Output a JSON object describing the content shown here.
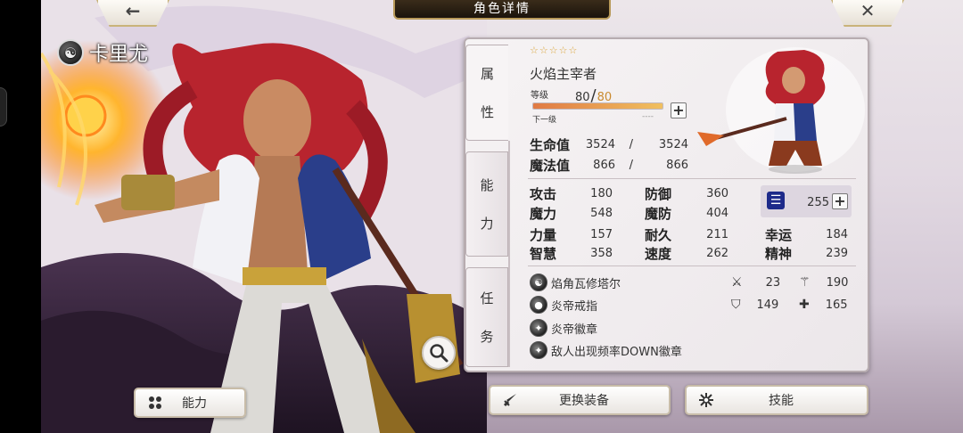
{
  "header": {
    "title": "角色详情",
    "back_glyph": "←",
    "close_glyph": "✕"
  },
  "character": {
    "name": "卡里尤",
    "element_icon": "dark-element-icon"
  },
  "tabs": {
    "attributes": [
      "属",
      "性"
    ],
    "ability": [
      "能",
      "力"
    ],
    "quest": [
      "任",
      "务"
    ]
  },
  "profile": {
    "stars": "☆☆☆☆☆",
    "title": "火焰主宰者",
    "level_label": "等级",
    "level": "80",
    "level_sep": "/",
    "level_max": "80",
    "level_progress": 1.0,
    "next_label": "下一级",
    "next_value": "----"
  },
  "vitals": [
    {
      "label": "生命值",
      "current": "3524",
      "sep": "/",
      "max": "3524"
    },
    {
      "label": "魔法值",
      "current": "866",
      "sep": "/",
      "max": "866"
    }
  ],
  "stats": {
    "atk_label": "攻击",
    "atk": "180",
    "def_label": "防御",
    "def": "360",
    "mag_label": "魔力",
    "mag": "548",
    "mdef_label": "魔防",
    "mdef": "404",
    "crest_value": "255",
    "str_label": "力量",
    "str": "157",
    "vit_label": "耐久",
    "vit": "211",
    "luck_label": "幸运",
    "luck": "184",
    "wis_label": "智慧",
    "wis": "358",
    "spd_label": "速度",
    "spd": "262",
    "spi_label": "精神",
    "spi": "239"
  },
  "equipment": [
    {
      "name": "焰角瓦修塔尔",
      "icon": "weapon-orb-icon"
    },
    {
      "name": "炎帝戒指",
      "icon": "ring-icon"
    },
    {
      "name": "炎帝徽章",
      "icon": "emblem-icon"
    },
    {
      "name": "敌人出现频率DOWN徽章",
      "icon": "emblem-icon"
    }
  ],
  "equip_stats": {
    "sword": "23",
    "staff": "190",
    "shield": "149",
    "armor": "165"
  },
  "buttons": {
    "ability": "能力",
    "change_equip": "更换装备",
    "skill": "技能"
  },
  "colors": {
    "accent_gold": "#c9b37a",
    "level_max": "#c98a2e",
    "crest_bg": "#ddd6e0"
  }
}
